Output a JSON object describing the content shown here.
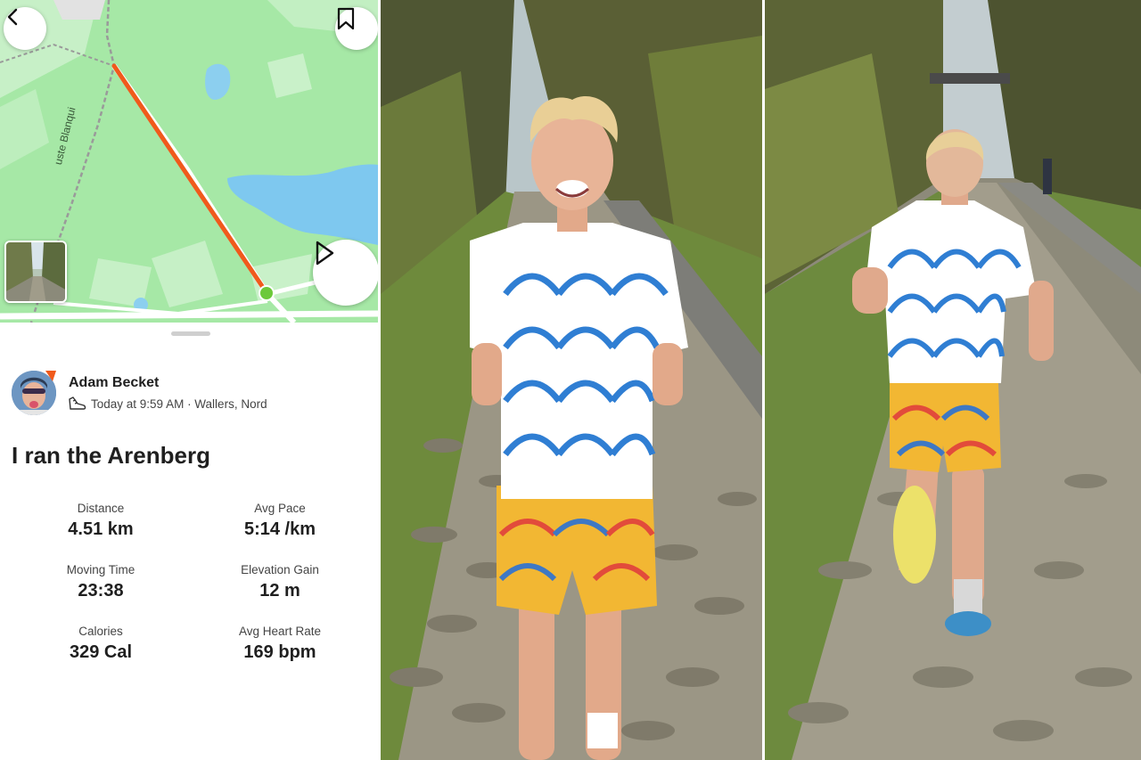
{
  "map": {
    "road_label": "uste Blanqui",
    "route_color": "#f05a1c",
    "end_marker_color": "#6cc93a"
  },
  "icons": {
    "back": "chevron-left-icon",
    "bookmark": "bookmark-icon",
    "play": "play-icon",
    "sport": "running-shoe-icon"
  },
  "athlete": {
    "name": "Adam Becket",
    "meta": "Today at 9:59 AM · Wallers, Nord"
  },
  "activity": {
    "title": "I ran the Arenberg"
  },
  "stats": [
    {
      "label": "Distance",
      "value": "4.51 km"
    },
    {
      "label": "Avg Pace",
      "value": "5:14 /km"
    },
    {
      "label": "Moving Time",
      "value": "23:38"
    },
    {
      "label": "Elevation Gain",
      "value": "12 m"
    },
    {
      "label": "Calories",
      "value": "329 Cal"
    },
    {
      "label": "Avg Heart Rate",
      "value": "169 bpm"
    }
  ]
}
